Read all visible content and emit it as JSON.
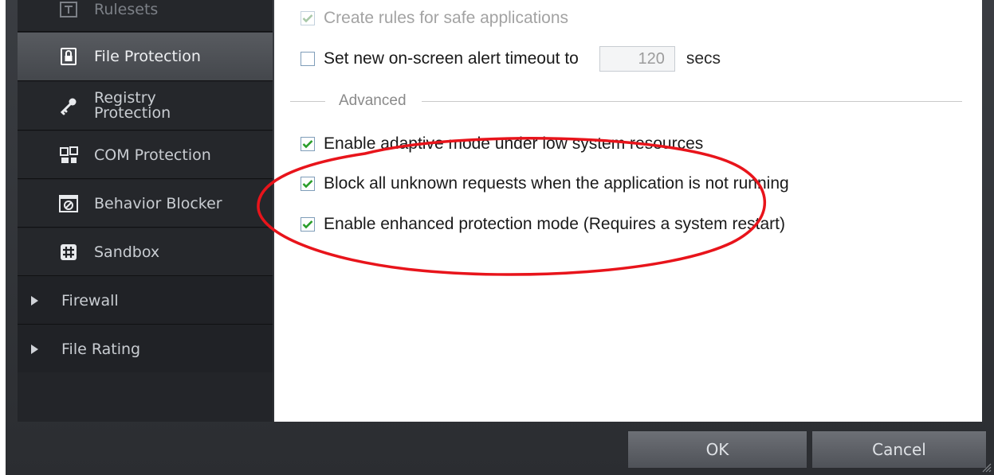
{
  "sidebar": {
    "items": [
      {
        "label": "Rulesets",
        "icon": "rulesets-icon"
      },
      {
        "label": "File Protection",
        "icon": "lock-icon"
      },
      {
        "label": "Registry Protection",
        "line1": "Registry",
        "line2": "Protection",
        "icon": "key-icon"
      },
      {
        "label": "COM Protection",
        "icon": "com-icon"
      },
      {
        "label": "Behavior Blocker",
        "icon": "behavior-blocker-icon"
      },
      {
        "label": "Sandbox",
        "icon": "sandbox-icon"
      },
      {
        "label": "Firewall",
        "icon": "expand-arrow-icon"
      },
      {
        "label": "File Rating",
        "icon": "expand-arrow-icon"
      }
    ],
    "selected": "File Protection"
  },
  "settings": {
    "create_rules": {
      "label": "Create rules for safe applications",
      "checked": true,
      "enabled": false
    },
    "alert_timeout": {
      "label": "Set new on-screen alert timeout to",
      "checked": false,
      "value": "120",
      "unit": "secs"
    },
    "advanced_header": "Advanced",
    "adaptive_mode": {
      "label": "Enable adaptive mode under low system resources",
      "checked": true
    },
    "block_unknown": {
      "label": "Block all unknown requests when the application is not running",
      "checked": true
    },
    "enhanced_mode": {
      "label": "Enable enhanced protection mode (Requires a system restart)",
      "checked": true
    }
  },
  "footer": {
    "ok_label": "OK",
    "cancel_label": "Cancel"
  },
  "colors": {
    "sidebar_bg": "#202226",
    "selected_bg": "#4f5257",
    "annotation": "#e8141b",
    "checkbox_tick": "#2a9d2a"
  }
}
